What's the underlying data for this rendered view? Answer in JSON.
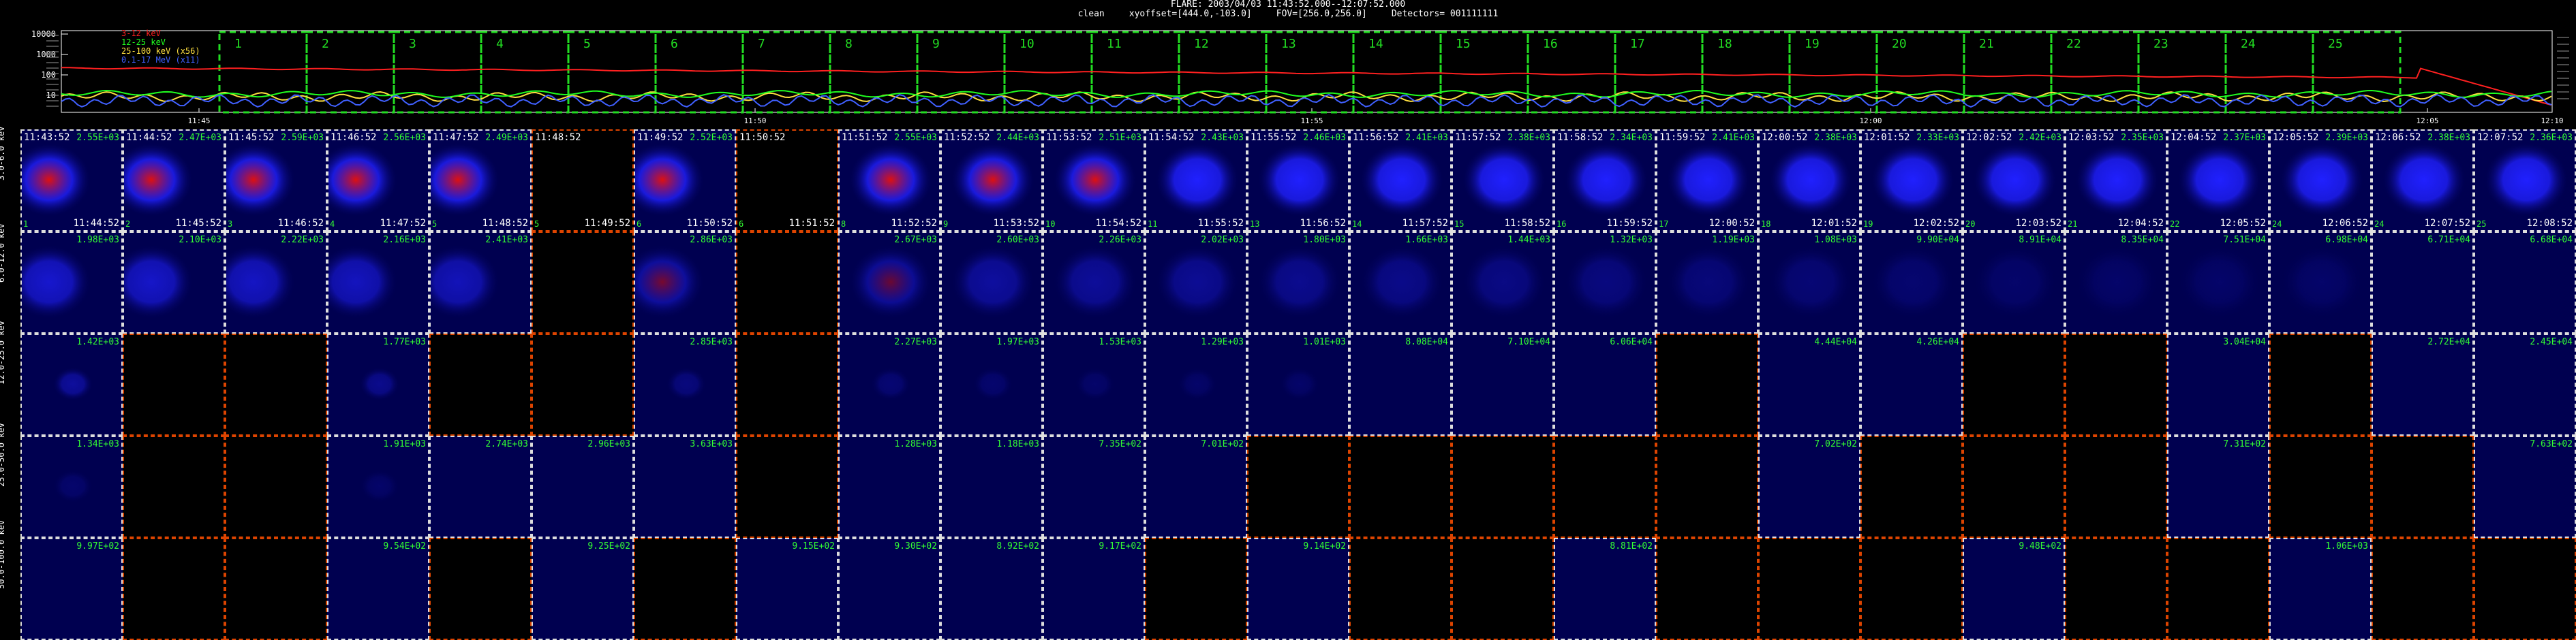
{
  "header": {
    "title": "FLARE: 2003/04/03 11:43:52.000--12:07:52.000",
    "clean": "clean",
    "xyoffset": "xyoffset=[444.0,-103.0]",
    "fov": "FOV=[256.0,256.0]",
    "detectors": "Detectors= 001111111"
  },
  "lightcurve": {
    "y_ticks": [
      "10000",
      "1000",
      "100",
      "10"
    ],
    "legend": [
      {
        "label": "3-12 keV",
        "color": "#ff2020"
      },
      {
        "label": "12-25 keV",
        "color": "#20ff20"
      },
      {
        "label": "25-100 keV (x56)",
        "color": "#ffe040"
      },
      {
        "label": "0.1-17 MeV (x11)",
        "color": "#4060ff"
      }
    ],
    "time_ticks": [
      "11:45",
      "11:50",
      "11:55",
      "12:00",
      "12:05",
      "12:10"
    ],
    "interval_numbers": [
      "1",
      "2",
      "3",
      "4",
      "5",
      "6",
      "7",
      "8",
      "9",
      "10",
      "11",
      "12",
      "13",
      "14",
      "15",
      "16",
      "17",
      "18",
      "19",
      "20",
      "21",
      "22",
      "23",
      "24",
      "25"
    ],
    "interval_box_color": "#22dd22"
  },
  "energy_bands": [
    "3.0-6.0 keV",
    "6.0-12.0 keV",
    "12.0-25.0 keV",
    "25.0-50.0 keV",
    "50.0-100.0 keV"
  ],
  "columns": [
    {
      "start": "11:43:52",
      "end": "11:44:52",
      "index": "1"
    },
    {
      "start": "11:44:52",
      "end": "11:45:52",
      "index": "2"
    },
    {
      "start": "11:45:52",
      "end": "11:46:52",
      "index": "3"
    },
    {
      "start": "11:46:52",
      "end": "11:47:52",
      "index": "4"
    },
    {
      "start": "11:47:52",
      "end": "11:48:52",
      "index": "5"
    },
    {
      "start": "11:48:52",
      "end": "11:49:52",
      "index": "5"
    },
    {
      "start": "11:49:52",
      "end": "11:50:52",
      "index": "6"
    },
    {
      "start": "11:50:52",
      "end": "11:51:52",
      "index": "6"
    },
    {
      "start": "11:51:52",
      "end": "11:52:52",
      "index": "8"
    },
    {
      "start": "11:52:52",
      "end": "11:53:52",
      "index": "9"
    },
    {
      "start": "11:53:52",
      "end": "11:54:52",
      "index": "10"
    },
    {
      "start": "11:54:52",
      "end": "11:55:52",
      "index": "11"
    },
    {
      "start": "11:55:52",
      "end": "11:56:52",
      "index": "13"
    },
    {
      "start": "11:56:52",
      "end": "11:57:52",
      "index": "14"
    },
    {
      "start": "11:57:52",
      "end": "11:58:52",
      "index": "15"
    },
    {
      "start": "11:58:52",
      "end": "11:59:52",
      "index": "16"
    },
    {
      "start": "11:59:52",
      "end": "12:00:52",
      "index": "17"
    },
    {
      "start": "12:00:52",
      "end": "12:01:52",
      "index": "18"
    },
    {
      "start": "12:01:52",
      "end": "12:02:52",
      "index": "19"
    },
    {
      "start": "12:02:52",
      "end": "12:03:52",
      "index": "20"
    },
    {
      "start": "12:03:52",
      "end": "12:04:52",
      "index": "21"
    },
    {
      "start": "12:04:52",
      "end": "12:05:52",
      "index": "22"
    },
    {
      "start": "12:05:52",
      "end": "12:06:52",
      "index": "24"
    },
    {
      "start": "12:06:52",
      "end": "12:07:52",
      "index": "24"
    },
    {
      "start": "12:07:52",
      "end": "12:08:52",
      "index": "25"
    }
  ],
  "maxima": [
    [
      "2.55E+03",
      "2.47E+03",
      "2.59E+03",
      "2.56E+03",
      "2.49E+03",
      "",
      "2.52E+03",
      "",
      "2.55E+03",
      "2.44E+03",
      "2.51E+03",
      "2.43E+03",
      "2.46E+03",
      "2.41E+03",
      "2.38E+03",
      "2.34E+03",
      "2.41E+03",
      "2.38E+03",
      "2.33E+03",
      "2.42E+03",
      "2.35E+03",
      "2.37E+03",
      "2.39E+03",
      "2.38E+03",
      "2.36E+03"
    ],
    [
      "1.98E+03",
      "2.10E+03",
      "2.22E+03",
      "2.16E+03",
      "2.41E+03",
      "",
      "2.86E+03",
      "",
      "2.67E+03",
      "2.60E+03",
      "2.26E+03",
      "2.02E+03",
      "1.80E+03",
      "1.66E+03",
      "1.44E+03",
      "1.32E+03",
      "1.19E+03",
      "1.08E+03",
      "9.90E+04",
      "8.91E+04",
      "8.35E+04",
      "7.51E+04",
      "6.98E+04",
      "6.71E+04",
      "6.68E+04"
    ],
    [
      "1.42E+03",
      "",
      "",
      "1.77E+03",
      "",
      "",
      "2.85E+03",
      "",
      "2.27E+03",
      "1.97E+03",
      "1.53E+03",
      "1.29E+03",
      "1.01E+03",
      "8.08E+04",
      "7.10E+04",
      "6.06E+04",
      "",
      "4.44E+04",
      "4.26E+04",
      "",
      "",
      "3.04E+04",
      "",
      "2.72E+04",
      "2.45E+04"
    ],
    [
      "1.34E+03",
      "",
      "",
      "1.91E+03",
      "2.74E+03",
      "2.96E+03",
      "3.63E+03",
      "",
      "1.28E+03",
      "1.18E+03",
      "7.35E+02",
      "7.01E+02",
      "",
      "",
      "",
      "",
      "",
      "7.02E+02",
      "",
      "",
      "",
      "7.31E+02",
      "",
      "",
      "7.63E+02"
    ],
    [
      "9.97E+02",
      "",
      "",
      "9.54E+02",
      "",
      "9.25E+02",
      "",
      "9.15E+02",
      "9.30E+02",
      "8.92E+02",
      "9.17E+02",
      "",
      "9.14E+02",
      "",
      "",
      "8.81E+02",
      "",
      "",
      "",
      "9.48E+02",
      "",
      "",
      "1.06E+03",
      "",
      ""
    ]
  ],
  "cell_state": [
    [
      "img",
      "img",
      "img",
      "img",
      "img",
      "empty",
      "img",
      "empty",
      "img",
      "img",
      "img",
      "img",
      "img",
      "img",
      "img",
      "img",
      "img",
      "img",
      "img",
      "img",
      "img",
      "img",
      "img",
      "img",
      "img"
    ],
    [
      "img",
      "img",
      "img",
      "img",
      "img",
      "empty",
      "img",
      "empty",
      "img",
      "img",
      "img",
      "img",
      "img",
      "img",
      "img",
      "img",
      "img",
      "img",
      "img",
      "img",
      "img",
      "img",
      "img",
      "img",
      "img"
    ],
    [
      "img",
      "empty",
      "empty",
      "img",
      "empty",
      "empty",
      "img",
      "empty",
      "img",
      "img",
      "img",
      "img",
      "img",
      "img",
      "img",
      "img",
      "empty",
      "img",
      "img",
      "empty",
      "empty",
      "img",
      "empty",
      "img",
      "img"
    ],
    [
      "img",
      "empty",
      "empty",
      "img",
      "img",
      "img",
      "img",
      "empty",
      "img",
      "img",
      "img",
      "img",
      "empty",
      "empty",
      "empty",
      "empty",
      "empty",
      "img",
      "empty",
      "empty",
      "empty",
      "img",
      "empty",
      "empty",
      "img"
    ],
    [
      "img",
      "empty",
      "empty",
      "img",
      "empty",
      "img",
      "empty",
      "img",
      "img",
      "img",
      "img",
      "empty",
      "img",
      "empty",
      "empty",
      "img",
      "empty",
      "empty",
      "empty",
      "img",
      "empty",
      "empty",
      "img",
      "empty",
      "empty"
    ]
  ],
  "colors": {
    "image_bg": "#000050",
    "source_blue": "#2020ff",
    "source_red": "#dd1010",
    "white_border": "#dddddd",
    "red_border": "#dd4400",
    "label_green": "#33ff33"
  }
}
